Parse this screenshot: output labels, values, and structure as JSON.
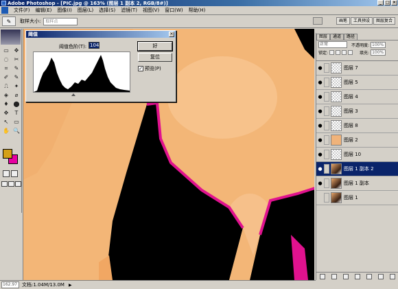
{
  "app": {
    "title": "Adobe Photoshop - [PIC.jpg @ 163% (图层 1 副本 2, RGB/8#)]",
    "window_buttons": [
      "_",
      "□",
      "×"
    ]
  },
  "menu": [
    "文件(F)",
    "编辑(E)",
    "图像(I)",
    "图层(L)",
    "选择(S)",
    "滤镜(T)",
    "视图(V)",
    "窗口(W)",
    "帮助(H)"
  ],
  "options": {
    "sample_size_label": "取样大小:",
    "sample_size_value": "取样点",
    "palette_tabs": [
      "画笔",
      "工具预设",
      "图层复合"
    ]
  },
  "toolbox": {
    "tools": [
      "▭",
      "✥",
      "◌",
      "✂",
      "⌗",
      "✎",
      "✐",
      "✎",
      "⎍",
      "✦",
      "◈",
      "⌀",
      "♦",
      "⬤",
      "✥",
      "T",
      "↖",
      "▭",
      "✋",
      "🔍"
    ],
    "foreground_color": "#d4a017",
    "background_color": "#e600a0"
  },
  "status": {
    "zoom": "162.97",
    "doc_label": "文档:1.04M/13.0M",
    "arrow": "▶"
  },
  "dialog": {
    "title": "阈值",
    "level_label": "阈值色阶(T):",
    "level_value": "104",
    "ok_label": "好",
    "reset_label": "复位",
    "preview_label": "预览(P)",
    "preview_checked": "✓",
    "close": "×"
  },
  "layers_panel": {
    "tabs": [
      "图层",
      "通道",
      "路径"
    ],
    "blend_mode": "正常",
    "opacity_label": "不透明度:",
    "opacity_value": "100%",
    "lock_label": "锁定:",
    "fill_label": "填充:",
    "fill_value": "100%",
    "layers": [
      {
        "name": "图层 7",
        "eye": "●",
        "thumb": "transparent"
      },
      {
        "name": "图层 5",
        "eye": "●",
        "thumb": "transparent"
      },
      {
        "name": "图层 4",
        "eye": "●",
        "thumb": "transparent"
      },
      {
        "name": "图层 3",
        "eye": "●",
        "thumb": "transparent"
      },
      {
        "name": "图层 8",
        "eye": "●",
        "thumb": "transparent"
      },
      {
        "name": "图层 2",
        "eye": "●",
        "thumb": "skin"
      },
      {
        "name": "图层 10",
        "eye": "●",
        "thumb": "transparent"
      },
      {
        "name": "图层 1 副本 2",
        "eye": "●",
        "thumb": "photo",
        "selected": true
      },
      {
        "name": "图层 1 副本",
        "eye": "●",
        "thumb": "photo"
      },
      {
        "name": "图层 1",
        "eye": "",
        "thumb": "photo"
      }
    ]
  }
}
